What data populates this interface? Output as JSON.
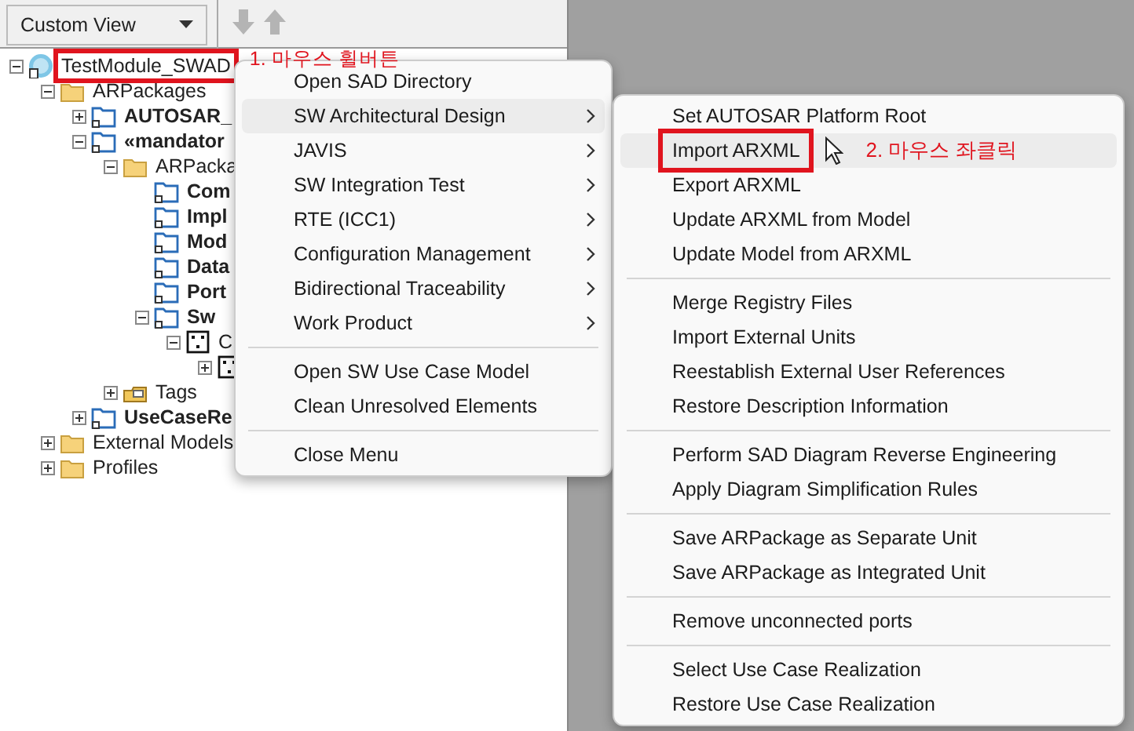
{
  "toolbar": {
    "view": "Custom View"
  },
  "tree": [
    {
      "label": "TestModule_SWAD",
      "kind": "logo",
      "bold": false,
      "expanded": true,
      "annotation": "1. 마우스 휠버튼",
      "children": [
        {
          "label": "ARPackages",
          "kind": "folder",
          "bold": false,
          "expanded": true,
          "children": [
            {
              "label": "AUTOSAR_",
              "kind": "package",
              "bold": true,
              "expanded": false
            },
            {
              "label": "«mandator",
              "kind": "package",
              "bold": true,
              "expanded": true,
              "children": [
                {
                  "label": "ARPacka",
                  "kind": "folder",
                  "bold": false,
                  "expanded": true,
                  "children": [
                    {
                      "label": "Com",
                      "kind": "package",
                      "bold": true
                    },
                    {
                      "label": "Impl",
                      "kind": "package",
                      "bold": true
                    },
                    {
                      "label": "Mod",
                      "kind": "package",
                      "bold": true
                    },
                    {
                      "label": "Data",
                      "kind": "package",
                      "bold": true
                    },
                    {
                      "label": "Port",
                      "kind": "package",
                      "bold": true
                    },
                    {
                      "label": "Sw",
                      "kind": "package",
                      "bold": true,
                      "expanded": true,
                      "children": [
                        {
                          "label": "C",
                          "kind": "component",
                          "bold": false,
                          "expanded": true,
                          "children": [
                            {
                              "kind": "component",
                              "expanded": false
                            }
                          ]
                        }
                      ]
                    }
                  ]
                },
                {
                  "label": "Tags",
                  "kind": "tags",
                  "bold": false,
                  "expanded": false
                }
              ]
            },
            {
              "label": "UseCaseRe",
              "kind": "package",
              "bold": true,
              "expanded": false
            }
          ]
        },
        {
          "label": "External Models",
          "kind": "folder",
          "bold": false,
          "expanded": false
        },
        {
          "label": "Profiles",
          "kind": "folder",
          "bold": false,
          "expanded": false
        }
      ]
    }
  ],
  "context_menu": [
    {
      "kind": "item",
      "label": "Open SAD Directory",
      "submenu": false,
      "selected": false
    },
    {
      "kind": "item",
      "label": "SW Architectural Design",
      "submenu": true,
      "selected": true
    },
    {
      "kind": "item",
      "label": "JAVIS",
      "submenu": true,
      "selected": false
    },
    {
      "kind": "item",
      "label": "SW Integration Test",
      "submenu": true,
      "selected": false
    },
    {
      "kind": "item",
      "label": "RTE (ICC1)",
      "submenu": true,
      "selected": false
    },
    {
      "kind": "item",
      "label": "Configuration Management",
      "submenu": true,
      "selected": false
    },
    {
      "kind": "item",
      "label": "Bidirectional Traceability",
      "submenu": true,
      "selected": false
    },
    {
      "kind": "item",
      "label": "Work Product",
      "submenu": true,
      "selected": false
    },
    {
      "kind": "separator"
    },
    {
      "kind": "item",
      "label": "Open SW Use Case Model",
      "submenu": false,
      "selected": false
    },
    {
      "kind": "item",
      "label": "Clean Unresolved Elements",
      "submenu": false,
      "selected": false
    },
    {
      "kind": "separator"
    },
    {
      "kind": "item",
      "label": "Close Menu",
      "submenu": false,
      "selected": false
    }
  ],
  "submenu": [
    {
      "kind": "item",
      "label": "Set AUTOSAR Platform Root",
      "selected": false
    },
    {
      "kind": "item",
      "label": "Import ARXML",
      "selected": true,
      "annotation": "2. 마우스 좌클릭"
    },
    {
      "kind": "item",
      "label": "Export ARXML",
      "selected": false
    },
    {
      "kind": "item",
      "label": "Update ARXML from Model",
      "selected": false
    },
    {
      "kind": "item",
      "label": "Update Model from ARXML",
      "selected": false
    },
    {
      "kind": "separator"
    },
    {
      "kind": "item",
      "label": "Merge Registry Files",
      "selected": false
    },
    {
      "kind": "item",
      "label": "Import External Units",
      "selected": false
    },
    {
      "kind": "item",
      "label": "Reestablish External User References",
      "selected": false
    },
    {
      "kind": "item",
      "label": "Restore Description Information",
      "selected": false
    },
    {
      "kind": "separator"
    },
    {
      "kind": "item",
      "label": "Perform SAD Diagram Reverse Engineering",
      "selected": false
    },
    {
      "kind": "item",
      "label": "Apply Diagram Simplification Rules",
      "selected": false
    },
    {
      "kind": "separator"
    },
    {
      "kind": "item",
      "label": "Save ARPackage as Separate Unit",
      "selected": false
    },
    {
      "kind": "item",
      "label": "Save ARPackage as Integrated Unit",
      "selected": false
    },
    {
      "kind": "separator"
    },
    {
      "kind": "item",
      "label": "Remove unconnected ports",
      "selected": false
    },
    {
      "kind": "separator"
    },
    {
      "kind": "item",
      "label": "Select Use Case Realization",
      "selected": false
    },
    {
      "kind": "item",
      "label": "Restore Use Case Realization",
      "selected": false
    }
  ]
}
